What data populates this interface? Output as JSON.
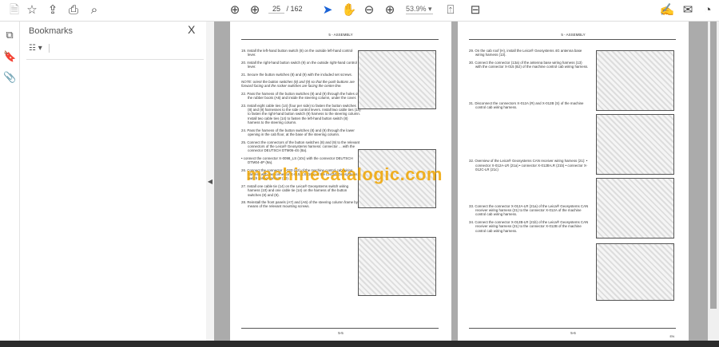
{
  "toolbar": {
    "page_current": "25",
    "page_total": "/ 162",
    "zoom": "53.9%"
  },
  "bookmarks": {
    "title": "Bookmarks",
    "close": "X",
    "options": "☷ ▾"
  },
  "left_page": {
    "header": "5 - ASSEMBLY",
    "page_number": "5-5",
    "steps": [
      "19. Install the left-hand button switch (8) on the outside left-hand control lever.",
      "20. Install the right-hand button switch (9) on the outside right-hand control lever.",
      "21. Secure the button switches (8) and (9) with the included set screws.",
      "NOTE: orient the button switches (8) and (9) so that the push buttons are forward facing and the rocker switches are facing the center-line.",
      "22. Pass the harness of the button switches (8) and (9) through the holes of the rubber boots (A6) and inside the steering column, under the cover.",
      "23. Install eight cable ties (14) (four per side) to fasten the button switches (8) and (9) harnesses to the side control levers. Install two cable ties (14) to fasten the right-hand button switch (9) harness to the steering column. Install two cable ties (14) to fasten the left-hand button switch (8) harness to the steering column.",
      "24. Pass the harness of the button switches (8) and (9) through the lower opening in the cab floor, at the base of the steering column.",
      "25. Connect the connectors of the button switches (8) and (9) to the relevant connectors of the Leica® Geosystems harness: connector ... with the connector DEUTSCH DTM06-4S (8a).",
      "• connect the connector X-0098_LS (10c) with the connector DEUTSCH DTM04-4P (9a).",
      "26. Connect the connector X-020 (A2) of the machine control cab wiring harness with the connector X-015_LS (10a) of the Leica® Geosystems switch wiring harness (10).",
      "27. Install one cable tie (14) on the Leica® Geosystems switch wiring harness (10) and one cable tie (14) on the harness of the button switches (8) and (9).",
      "28. Reinstall the front panels (A7) and (A6) of the steering column frame by means of the relevant mounting screws."
    ]
  },
  "right_page": {
    "header": "5 - ASSEMBLY",
    "page_number": "5-6",
    "lang": "EN",
    "steps": [
      "29. On the cab roof (H), install the Leica® Geosystems 4G antenna base wiring harness (13).",
      "30. Connect the connector (13a) of the antenna base wiring harness (13) with the connector X-015 (BJ) of the machine control cab wiring harness.",
      "31. Disconnect the connectors X-012A (R) and X-012B (S) of the machine control cab wiring harness.",
      "32. Overview of the Leica® Geosystems CAN receiver wiring harness (21): • connector X-012A-LR (21a) • connector X-012B-LR (21b) • connector X-012C-LR (21c)",
      "33. Connect the connector X-012A-LR (21a) of the Leica® Geosystems CAN receiver wiring harness (21) to the connector X-012A of the machine control cab wiring harness.",
      "34. Connect the connector X-012B-LR (21b) of the Leica® Geosystems CAN receiver wiring harness (21) to the connector X-012B of the machine control cab wiring harness."
    ]
  },
  "watermark": "machinecatalogic.com"
}
